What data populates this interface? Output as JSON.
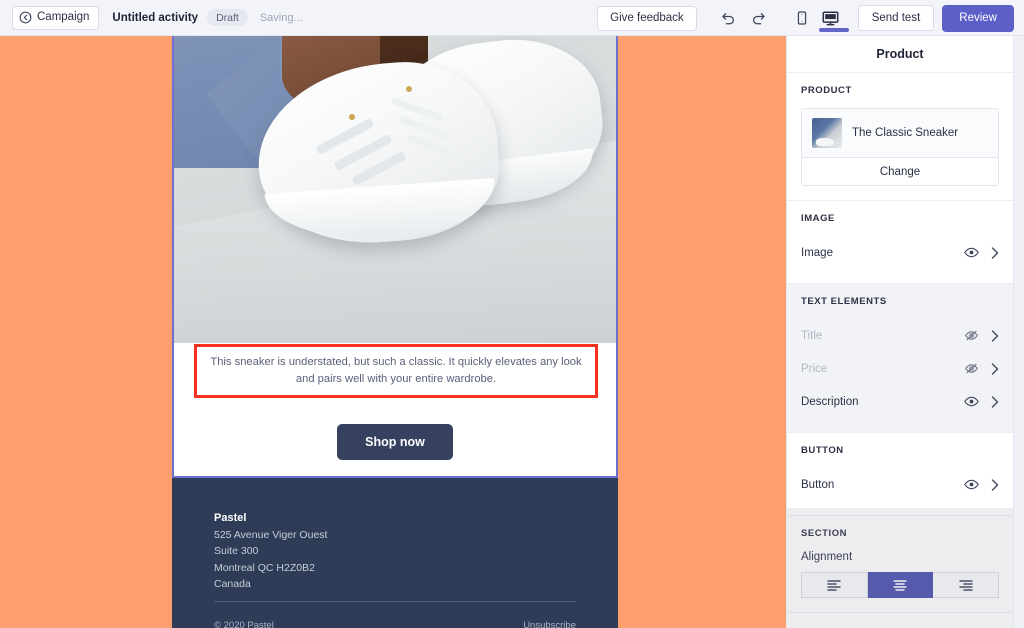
{
  "topbar": {
    "back_label": "Campaign",
    "back_icon": "circle-arrow-left-icon",
    "activity_title": "Untitled activity",
    "status_pill": "Draft",
    "saving_text": "Saving...",
    "feedback_label": "Give feedback",
    "undo_icon": "undo-icon",
    "redo_icon": "redo-icon",
    "mobile_icon": "mobile-preview-icon",
    "desktop_icon": "desktop-preview-icon",
    "active_device": "desktop",
    "send_test_label": "Send test",
    "review_label": "Review",
    "accent_color": "#5b5fc7"
  },
  "canvas": {
    "background_color": "#fc9e6e",
    "selection_border_color": "#6f6fd0",
    "highlight_border_color": "#f5311f",
    "email": {
      "hero_image_alt": "white sneakers on light floor",
      "description": "This sneaker is understated, but such a classic. It quickly elevates any look and pairs well with your entire wardrobe.",
      "cta_label": "Shop now",
      "cta_color": "#35415e",
      "footer": {
        "background_color": "#2e3c57",
        "brand": "Pastel",
        "address": [
          "525 Avenue Viger Ouest",
          "Suite 300",
          "Montreal QC H2Z0B2",
          "Canada"
        ],
        "copyright": "© 2020 Pastel",
        "unsubscribe": "Unsubscribe"
      }
    }
  },
  "panel": {
    "title": "Product",
    "sections": [
      {
        "heading": "PRODUCT",
        "product": {
          "name": "The Classic Sneaker",
          "thumb_icon": "product-thumbnail-icon"
        },
        "change_label": "Change"
      },
      {
        "heading": "IMAGE",
        "rows": [
          {
            "label": "Image",
            "visible": true,
            "icon": "eye-icon",
            "chevron": "chevron-right-icon"
          }
        ]
      },
      {
        "heading": "TEXT ELEMENTS",
        "rows": [
          {
            "label": "Title",
            "visible": false,
            "icon": "eye-off-icon",
            "chevron": "chevron-right-icon"
          },
          {
            "label": "Price",
            "visible": false,
            "icon": "eye-off-icon",
            "chevron": "chevron-right-icon"
          },
          {
            "label": "Description",
            "visible": true,
            "icon": "eye-icon",
            "chevron": "chevron-right-icon"
          }
        ]
      },
      {
        "heading": "BUTTON",
        "rows": [
          {
            "label": "Button",
            "visible": true,
            "icon": "eye-icon",
            "chevron": "chevron-right-icon"
          }
        ]
      },
      {
        "heading": "SECTION",
        "alignment_label": "Alignment",
        "alignment_options": [
          "left",
          "center",
          "right"
        ],
        "alignment_selected": "center",
        "selected_color": "#4c50b0"
      }
    ]
  }
}
